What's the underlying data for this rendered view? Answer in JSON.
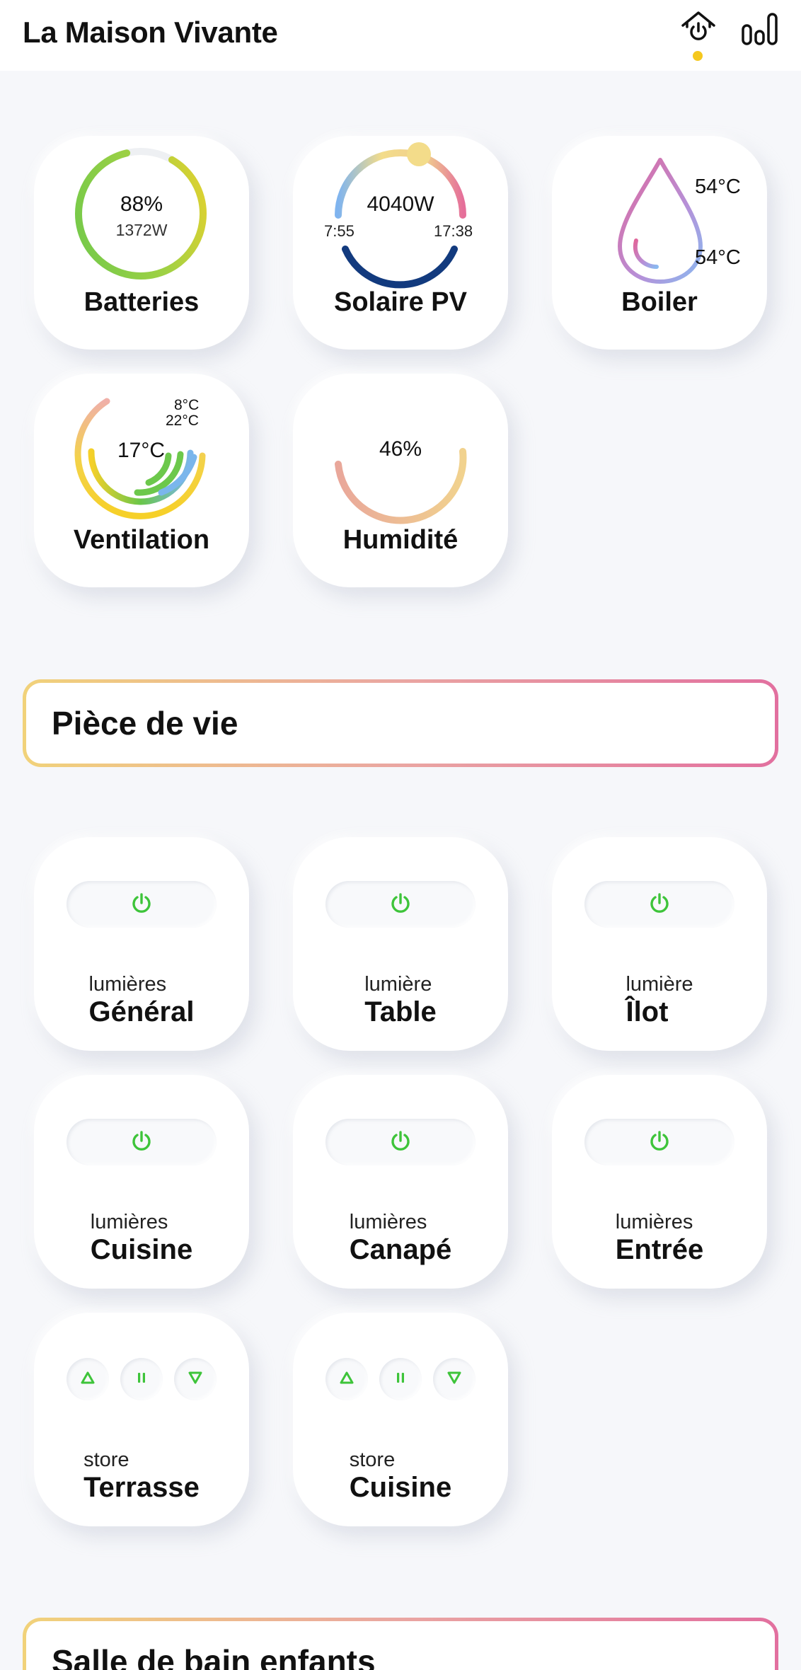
{
  "app": {
    "title": "La Maison Vivante"
  },
  "colors": {
    "accent_dot": "#f5c81e",
    "power_green": "#3ec43a",
    "section_grad_start": "#f1d27a",
    "section_grad_end": "#e2709f"
  },
  "header": {
    "icons": [
      "home-power-icon",
      "bar-chart-icon"
    ]
  },
  "summary_cards": {
    "batteries": {
      "label": "Batteries",
      "percent": "88%",
      "power": "1372W",
      "level": 0.88
    },
    "solar": {
      "label": "Solaire PV",
      "power": "4040W",
      "sunrise": "7:55",
      "sunset": "17:38"
    },
    "boiler": {
      "label": "Boiler",
      "temp_top": "54°C",
      "temp_bottom": "54°C"
    },
    "ventilation": {
      "label": "Ventilation",
      "temp_main": "17°C",
      "temp_out": "8°C",
      "temp_in": "22°C"
    },
    "humidity": {
      "label": "Humidité",
      "value": "46%",
      "level": 0.46
    }
  },
  "sections": [
    {
      "title": "Pièce de vie"
    },
    {
      "title": "Salle de bain enfants"
    }
  ],
  "controls": {
    "light_general": {
      "small": "lumières",
      "big": "Général"
    },
    "light_table": {
      "small": "lumière",
      "big": "Table"
    },
    "light_ilot": {
      "small": "lumière",
      "big": "Îlot"
    },
    "light_cuisine": {
      "small": "lumières",
      "big": "Cuisine"
    },
    "light_canape": {
      "small": "lumières",
      "big": "Canapé"
    },
    "light_entree": {
      "small": "lumières",
      "big": "Entrée"
    },
    "store_terrasse": {
      "small": "store",
      "big": "Terrasse"
    },
    "store_cuisine": {
      "small": "store",
      "big": "Cuisine"
    }
  }
}
